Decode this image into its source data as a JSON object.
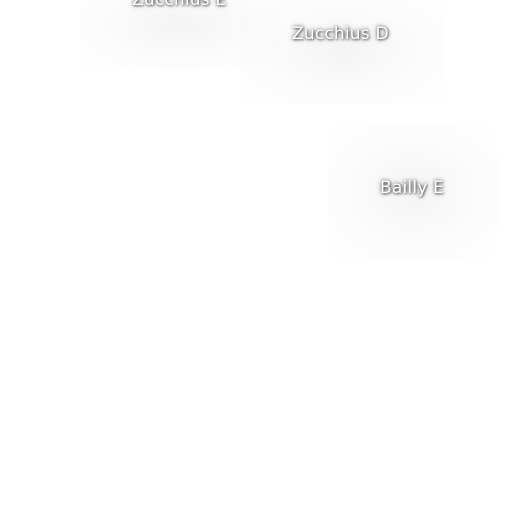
{
  "map": {
    "labels": [
      {
        "name": "Zucchius E"
      },
      {
        "name": "Zucchius D"
      },
      {
        "name": "Bailly E"
      }
    ]
  }
}
